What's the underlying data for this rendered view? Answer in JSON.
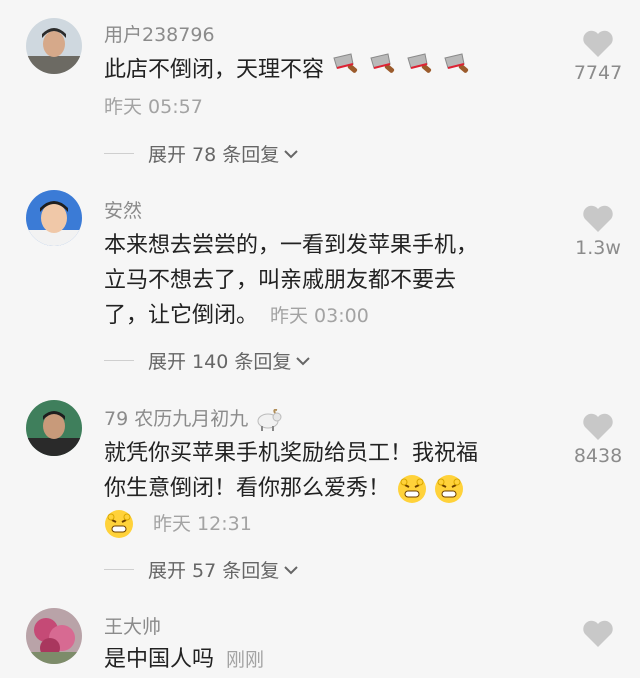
{
  "comments": [
    {
      "username": "用户238796",
      "text": "此店不倒闭，天理不容",
      "emoji_count": 4,
      "time": "昨天 05:57",
      "likes": "7747",
      "replies": "展开 78 条回复"
    },
    {
      "username": "安然",
      "text_lines": [
        "本来想去尝尝的，一看到发苹果手机，",
        "立马不想去了，叫亲戚朋友都不要去",
        "了，让它倒闭。"
      ],
      "time": "昨天 03:00",
      "likes": "1.3w",
      "replies": "展开 140 条回复"
    },
    {
      "username": "79 农历九月初九",
      "text_lines": [
        "就凭你买苹果手机奖励给员工！我祝福",
        "你生意倒闭！看你那么爱秀！"
      ],
      "time": "昨天 12:31",
      "likes": "8438",
      "replies": "展开 57 条回复"
    },
    {
      "username": "王大帅",
      "text": "是中国人吗",
      "time": "刚刚",
      "likes": ""
    }
  ],
  "icons": {
    "heart": "heart-icon",
    "chevron": "chevron-down-icon",
    "goat": "goat-icon",
    "emoji_knife": "cleaver-emoji",
    "emoji_grin": "grimace-emoji"
  },
  "colors": {
    "background": "#f6f6f6",
    "username": "#8b8b8b",
    "text": "#222222",
    "time": "#a3a3a3",
    "heart": "#c8c8c8"
  }
}
